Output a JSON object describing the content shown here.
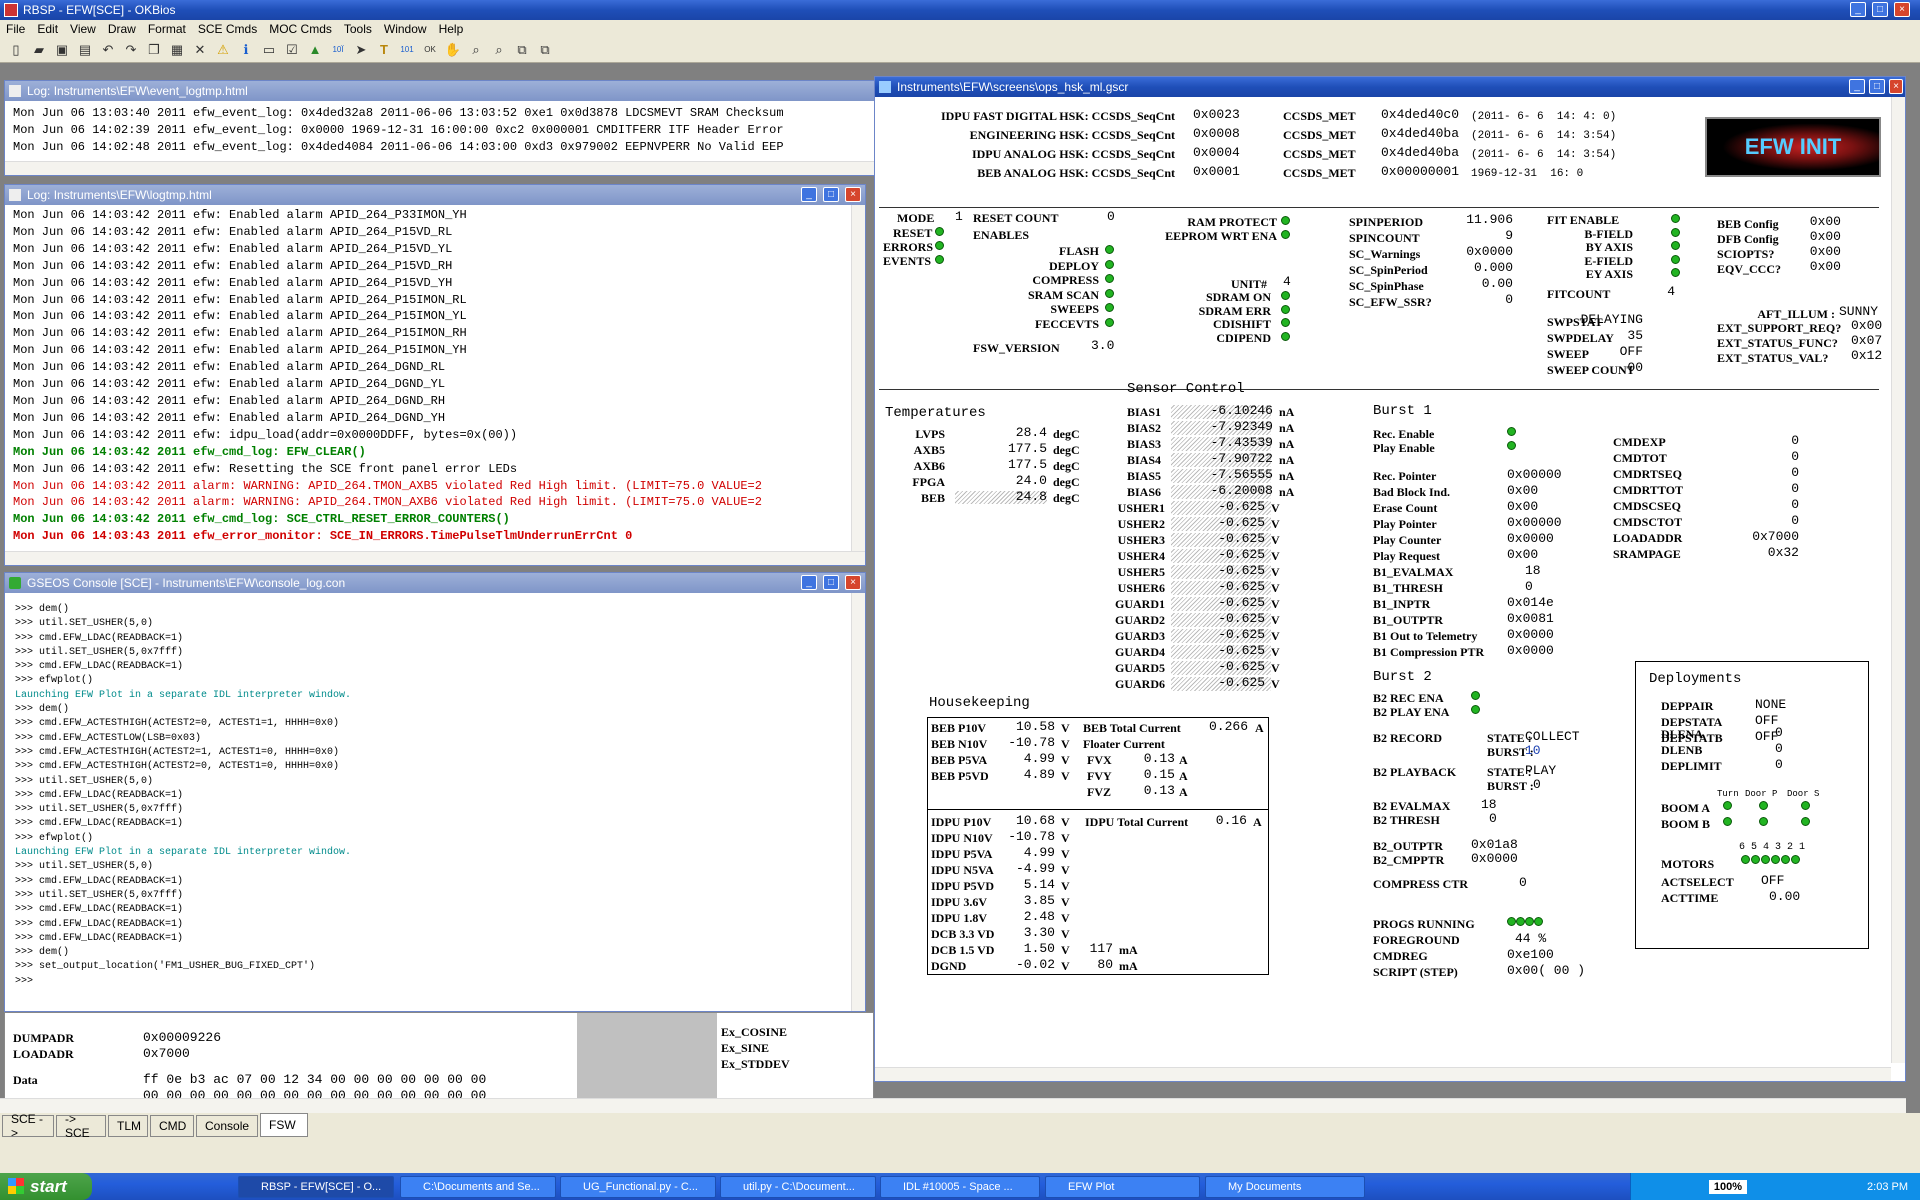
{
  "app": {
    "title": "RBSP - EFW[SCE] - OKBios"
  },
  "menu": [
    "File",
    "Edit",
    "View",
    "Draw",
    "Format",
    "SCE Cmds",
    "MOC Cmds",
    "Tools",
    "Window",
    "Help"
  ],
  "event_log": {
    "title": "Log: Instruments\\EFW\\event_logtmp.html",
    "lines": [
      "Mon Jun 06 13:03:40 2011 efw_event_log: 0x4ded32a8 2011-06-06 13:03:52 0xe1 0x0d3878 LDCSMEVT SRAM Checksum",
      "Mon Jun 06 14:02:39 2011 efw_event_log: 0x0000 1969-12-31 16:00:00 0xc2 0x000001 CMDITFERR ITF Header Error",
      "Mon Jun 06 14:02:48 2011 efw_event_log: 0x4ded4084 2011-06-06 14:03:00 0xd3 0x979002 EEPNVPERR No Valid EEP"
    ]
  },
  "logtmp": {
    "title": "Log: Instruments\\EFW\\logtmp.html",
    "lines": [
      {
        "t": "Mon Jun 06 14:03:42 2011 efw: Enabled alarm APID_264_P33IMON_YH",
        "c": "normal"
      },
      {
        "t": "Mon Jun 06 14:03:42 2011 efw: Enabled alarm APID_264_P15VD_RL",
        "c": "normal"
      },
      {
        "t": "Mon Jun 06 14:03:42 2011 efw: Enabled alarm APID_264_P15VD_YL",
        "c": "normal"
      },
      {
        "t": "Mon Jun 06 14:03:42 2011 efw: Enabled alarm APID_264_P15VD_RH",
        "c": "normal"
      },
      {
        "t": "Mon Jun 06 14:03:42 2011 efw: Enabled alarm APID_264_P15VD_YH",
        "c": "normal"
      },
      {
        "t": "Mon Jun 06 14:03:42 2011 efw: Enabled alarm APID_264_P15IMON_RL",
        "c": "normal"
      },
      {
        "t": "Mon Jun 06 14:03:42 2011 efw: Enabled alarm APID_264_P15IMON_YL",
        "c": "normal"
      },
      {
        "t": "Mon Jun 06 14:03:42 2011 efw: Enabled alarm APID_264_P15IMON_RH",
        "c": "normal"
      },
      {
        "t": "Mon Jun 06 14:03:42 2011 efw: Enabled alarm APID_264_P15IMON_YH",
        "c": "normal"
      },
      {
        "t": "Mon Jun 06 14:03:42 2011 efw: Enabled alarm APID_264_DGND_RL",
        "c": "normal"
      },
      {
        "t": "Mon Jun 06 14:03:42 2011 efw: Enabled alarm APID_264_DGND_YL",
        "c": "normal"
      },
      {
        "t": "Mon Jun 06 14:03:42 2011 efw: Enabled alarm APID_264_DGND_RH",
        "c": "normal"
      },
      {
        "t": "Mon Jun 06 14:03:42 2011 efw: Enabled alarm APID_264_DGND_YH",
        "c": "normal"
      },
      {
        "t": "Mon Jun 06 14:03:42 2011 efw: idpu_load(addr=0x0000DDFF, bytes=0x(00))",
        "c": "normal"
      },
      {
        "t": "Mon Jun 06 14:03:42 2011 efw_cmd_log: EFW_CLEAR()",
        "c": "green"
      },
      {
        "t": "Mon Jun 06 14:03:42 2011 efw: Resetting the SCE front panel error LEDs",
        "c": "normal"
      },
      {
        "t": "Mon Jun 06 14:03:42 2011 alarm: WARNING: APID_264.TMON_AXB5 violated Red High limit. (LIMIT=75.0 VALUE=2",
        "c": "red"
      },
      {
        "t": "Mon Jun 06 14:03:42 2011 alarm: WARNING: APID_264.TMON_AXB6 violated Red High limit. (LIMIT=75.0 VALUE=2",
        "c": "red"
      },
      {
        "t": "Mon Jun 06 14:03:42 2011 efw_cmd_log: SCE_CTRL_RESET_ERROR_COUNTERS()",
        "c": "green"
      },
      {
        "t": "Mon Jun 06 14:03:43 2011 efw_error_monitor: SCE_IN_ERRORS.TimePulseTlmUnderrunErrCnt 0",
        "c": "redbold"
      }
    ]
  },
  "console": {
    "title": "GSEOS Console  [SCE] - Instruments\\EFW\\console_log.con",
    "lines": [
      {
        "t": ">>> dem()",
        "c": "normal"
      },
      {
        "t": ">>> util.SET_USHER(5,0)",
        "c": "normal"
      },
      {
        "t": ">>> cmd.EFW_LDAC(READBACK=1)",
        "c": "normal"
      },
      {
        "t": ">>> util.SET_USHER(5,0x7fff)",
        "c": "normal"
      },
      {
        "t": ">>> cmd.EFW_LDAC(READBACK=1)",
        "c": "normal"
      },
      {
        "t": ">>> efwplot()",
        "c": "normal"
      },
      {
        "t": "Launching EFW Plot in a separate IDL interpreter window.",
        "c": "teal"
      },
      {
        "t": ">>> dem()",
        "c": "normal"
      },
      {
        "t": ">>> cmd.EFW_ACTESTHIGH(ACTEST2=0, ACTEST1=1, HHHH=0x0)",
        "c": "normal"
      },
      {
        "t": ">>> cmd.EFW_ACTESTLOW(LSB=0x03)",
        "c": "normal"
      },
      {
        "t": ">>> cmd.EFW_ACTESTHIGH(ACTEST2=1, ACTEST1=0, HHHH=0x0)",
        "c": "normal"
      },
      {
        "t": ">>> cmd.EFW_ACTESTHIGH(ACTEST2=0, ACTEST1=0, HHHH=0x0)",
        "c": "normal"
      },
      {
        "t": ">>> util.SET_USHER(5,0)",
        "c": "normal"
      },
      {
        "t": ">>> cmd.EFW_LDAC(READBACK=1)",
        "c": "normal"
      },
      {
        "t": ">>> util.SET_USHER(5,0x7fff)",
        "c": "normal"
      },
      {
        "t": ">>> cmd.EFW_LDAC(READBACK=1)",
        "c": "normal"
      },
      {
        "t": ">>> efwplot()",
        "c": "normal"
      },
      {
        "t": "Launching EFW Plot in a separate IDL interpreter window.",
        "c": "teal"
      },
      {
        "t": ">>> util.SET_USHER(5,0)",
        "c": "normal"
      },
      {
        "t": ">>> cmd.EFW_LDAC(READBACK=1)",
        "c": "normal"
      },
      {
        "t": ">>> util.SET_USHER(5,0x7fff)",
        "c": "normal"
      },
      {
        "t": ">>> cmd.EFW_LDAC(READBACK=1)",
        "c": "normal"
      },
      {
        "t": ">>> cmd.EFW_LDAC(READBACK=1)",
        "c": "normal"
      },
      {
        "t": ">>> cmd.EFW_LDAC(READBACK=1)",
        "c": "normal"
      },
      {
        "t": ">>> dem()",
        "c": "normal"
      },
      {
        "t": ">>> set_output_location('FM1_USHER_BUG_FIXED_CPT')",
        "c": "normal"
      },
      {
        "t": ">>>",
        "c": "normal"
      }
    ]
  },
  "bg_panel": {
    "dumpadr_label": "DUMPADR",
    "dumpadr": "0x00009226",
    "loadadr_label": "LOADADR",
    "loadadr": "0x7000",
    "data_label": "Data",
    "data_row1": "ff 0e b3 ac 07 00 12 34 00 00 00 00 00 00 00",
    "data_row2": "00 00 00 00 00 00 00 00 00 00 00 00 00 00 00",
    "ex_cosine": "Ex_COSINE",
    "ex_sine": "Ex_SINE",
    "ex_stddev": "Ex_STDDEV"
  },
  "tabs": [
    "SCE ->",
    "-> SCE",
    "TLM",
    "CMD",
    "Console",
    "FSW"
  ],
  "hsk": {
    "title": "Instruments\\EFW\\screens\\ops_hsk_ml.gscr",
    "logo": "EFW INIT",
    "header_rows": [
      {
        "label": "IDPU FAST DIGITAL HSK: CCSDS_SeqCnt",
        "seq": "0x0023",
        "met_label": "CCSDS_MET",
        "met": "0x4ded40c0",
        "time": "(2011- 6- 6  14: 4: 0)"
      },
      {
        "label": "ENGINEERING HSK: CCSDS_SeqCnt",
        "seq": "0x0008",
        "met_label": "CCSDS_MET",
        "met": "0x4ded40ba",
        "time": "(2011- 6- 6  14: 3:54)"
      },
      {
        "label": "IDPU ANALOG HSK: CCSDS_SeqCnt",
        "seq": "0x0004",
        "met_label": "CCSDS_MET",
        "met": "0x4ded40ba",
        "time": "(2011- 6- 6  14: 3:54)"
      },
      {
        "label": "BEB ANALOG HSK: CCSDS_SeqCnt",
        "seq": "0x0001",
        "met_label": "CCSDS_MET",
        "met": "0x00000001",
        "time": "1969-12-31  16: 0"
      }
    ],
    "mode": {
      "mode_label": "MODE",
      "mode": "1",
      "reset": "RESET",
      "errors": "ERRORS",
      "events": "EVENTS"
    },
    "reset_count_label": "RESET COUNT",
    "reset_count": "0",
    "enables_label": "ENABLES",
    "enables": [
      "FLASH",
      "DEPLOY",
      "COMPRESS",
      "SRAM SCAN",
      "SWEEPS",
      "FECCEVTS"
    ],
    "fsw_version_label": "FSW_VERSION",
    "fsw_version": "3.0",
    "ram_protect": "RAM PROTECT",
    "eeprom_wrt": "EEPROM WRT ENA",
    "unit_label": "UNIT#",
    "unit": "4",
    "unit_flags": [
      "SDRAM ON",
      "SDRAM ERR",
      "CDISHIFT",
      "CDIPEND"
    ],
    "spin": [
      {
        "l": "SPINPERIOD",
        "v": "11.906"
      },
      {
        "l": "SPINCOUNT",
        "v": "9"
      },
      {
        "l": "SC_Warnings",
        "v": "0x0000"
      },
      {
        "l": "SC_SpinPeriod",
        "v": "0.000"
      },
      {
        "l": "SC_SpinPhase",
        "v": "0.00"
      },
      {
        "l": "SC_EFW_SSR?",
        "v": "0"
      }
    ],
    "fit": {
      "fit_enable": "FIT ENABLE",
      "bfield": "B-FIELD",
      "byaxis": "BY AXIS",
      "efield": "E-FIELD",
      "eyaxis": "EY AXIS",
      "fitcount_label": "FITCOUNT",
      "fitcount": "4"
    },
    "config": [
      {
        "l": "BEB Config",
        "v": "0x00"
      },
      {
        "l": "DFB Config",
        "v": "0x00"
      },
      {
        "l": "SCIOPTS?",
        "v": "0x00"
      },
      {
        "l": "EQV_CCC?",
        "v": "0x00"
      }
    ],
    "aft_illum_label": "AFT_ILLUM :",
    "aft_illum": "SUNNY",
    "ext": [
      {
        "l": "EXT_SUPPORT_REQ?",
        "v": "0x00"
      },
      {
        "l": "EXT_STATUS_FUNC?",
        "v": "0x07"
      },
      {
        "l": "EXT_STATUS_VAL?",
        "v": "0x12"
      }
    ],
    "sweep": [
      {
        "l": "SWPSTAT",
        "v": "DELAYING"
      },
      {
        "l": "SWPDELAY",
        "v": "35"
      },
      {
        "l": "SWEEP",
        "v": "OFF"
      },
      {
        "l": "SWEEP COUNT",
        "v": "00"
      }
    ],
    "temps_title": "Temperatures",
    "temps": [
      {
        "l": "LVPS",
        "v": "28.4",
        "u": "degC"
      },
      {
        "l": "AXB5",
        "v": "177.5",
        "u": "degC"
      },
      {
        "l": "AXB6",
        "v": "177.5",
        "u": "degC"
      },
      {
        "l": "FPGA",
        "v": "24.0",
        "u": "degC"
      },
      {
        "l": "BEB",
        "v": "24.8",
        "u": "degC"
      }
    ],
    "sensor_title": "Sensor Control",
    "bias": [
      {
        "l": "BIAS1",
        "v": "-6.10246",
        "u": "nA"
      },
      {
        "l": "BIAS2",
        "v": "-7.92349",
        "u": "nA"
      },
      {
        "l": "BIAS3",
        "v": "-7.43539",
        "u": "nA"
      },
      {
        "l": "BIAS4",
        "v": "-7.90722",
        "u": "nA"
      },
      {
        "l": "BIAS5",
        "v": "-7.56555",
        "u": "nA"
      },
      {
        "l": "BIAS6",
        "v": "-6.20008",
        "u": "nA"
      }
    ],
    "usher": [
      {
        "l": "USHER1",
        "v": "-0.625",
        "u": "V"
      },
      {
        "l": "USHER2",
        "v": "-0.625",
        "u": "V"
      },
      {
        "l": "USHER3",
        "v": "-0.625",
        "u": "V"
      },
      {
        "l": "USHER4",
        "v": "-0.625",
        "u": "V"
      },
      {
        "l": "USHER5",
        "v": "-0.625",
        "u": "V"
      },
      {
        "l": "USHER6",
        "v": "-0.625",
        "u": "V"
      },
      {
        "l": "GUARD1",
        "v": "-0.625",
        "u": "V"
      },
      {
        "l": "GUARD2",
        "v": "-0.625",
        "u": "V"
      },
      {
        "l": "GUARD3",
        "v": "-0.625",
        "u": "V"
      },
      {
        "l": "GUARD4",
        "v": "-0.625",
        "u": "V"
      },
      {
        "l": "GUARD5",
        "v": "-0.625",
        "u": "V"
      },
      {
        "l": "GUARD6",
        "v": "-0.625",
        "u": "V"
      }
    ],
    "hk_title": "Housekeeping",
    "beb": [
      {
        "l": "BEB P10V",
        "v": "10.58",
        "u": "V"
      },
      {
        "l": "BEB N10V",
        "v": "-10.78",
        "u": "V"
      },
      {
        "l": "BEB P5VA",
        "v": "4.99",
        "u": "V"
      },
      {
        "l": "BEB P5VD",
        "v": "4.89",
        "u": "V"
      }
    ],
    "beb_total_label": "BEB Total Current",
    "beb_total": "0.266",
    "beb_total_unit": "A",
    "floater_label": "Floater Current",
    "floater": [
      {
        "l": "FVX",
        "v": "0.13",
        "u": "A"
      },
      {
        "l": "FVY",
        "v": "0.15",
        "u": "A"
      },
      {
        "l": "FVZ",
        "v": "0.13",
        "u": "A"
      }
    ],
    "idpu": [
      {
        "l": "IDPU P10V",
        "v": "10.68",
        "u": "V"
      },
      {
        "l": "IDPU N10V",
        "v": "-10.78",
        "u": "V"
      },
      {
        "l": "IDPU P5VA",
        "v": "4.99",
        "u": "V"
      },
      {
        "l": "IDPU N5VA",
        "v": "-4.99",
        "u": "V"
      },
      {
        "l": "IDPU P5VD",
        "v": "5.14",
        "u": "V"
      },
      {
        "l": "IDPU 3.6V",
        "v": "3.85",
        "u": "V"
      },
      {
        "l": "IDPU 1.8V",
        "v": "2.48",
        "u": "V"
      },
      {
        "l": "DCB 3.3 VD",
        "v": "3.30",
        "u": "V"
      },
      {
        "l": "DCB 1.5 VD",
        "v": "1.50",
        "u": "V"
      },
      {
        "l": "DGND",
        "v": "-0.02",
        "u": "V"
      }
    ],
    "idpu_total_label": "IDPU Total Current",
    "idpu_total": "0.16",
    "idpu_total_unit": "A",
    "dcb33_ma": "117",
    "dcb15_ma": "80",
    "ma_unit": "mA",
    "burst1_title": "Burst 1",
    "rec_enable": "Rec. Enable",
    "play_enable": "Play Enable",
    "burst1": [
      {
        "l": "Rec. Pointer",
        "v": "0x00000"
      },
      {
        "l": "Bad Block Ind.",
        "v": "0x00"
      },
      {
        "l": "Erase Count",
        "v": "0x00"
      },
      {
        "l": "Play Pointer",
        "v": "0x00000"
      },
      {
        "l": "Play Counter",
        "v": "0x0000"
      },
      {
        "l": "Play Request",
        "v": "0x00"
      },
      {
        "l": "B1_EVALMAX",
        "v": "18"
      },
      {
        "l": "B1_THRESH",
        "v": "0"
      },
      {
        "l": "B1_INPTR",
        "v": "0x014e"
      },
      {
        "l": "B1_OUTPTR",
        "v": "0x0081"
      },
      {
        "l": "B1 Out to Telemetry",
        "v": "0x0000"
      },
      {
        "l": "B1 Compression PTR",
        "v": "0x0000"
      }
    ],
    "cmd": [
      {
        "l": "CMDEXP",
        "v": "0"
      },
      {
        "l": "CMDTOT",
        "v": "0"
      },
      {
        "l": "CMDRTSEQ",
        "v": "0"
      },
      {
        "l": "CMDRTTOT",
        "v": "0"
      },
      {
        "l": "CMDSCSEQ",
        "v": "0"
      },
      {
        "l": "CMDSCTOT",
        "v": "0"
      },
      {
        "l": "LOADADDR",
        "v": "0x7000"
      },
      {
        "l": "SRAMPAGE",
        "v": "0x32"
      }
    ],
    "burst2_title": "Burst 2",
    "b2_rec_ena": "B2 REC ENA",
    "b2_play_ena": "B2 PLAY ENA",
    "b2_record": "B2 RECORD",
    "b2_playback": "B2 PLAYBACK",
    "state_label": "STATE :",
    "burst_label": "BURST :",
    "b2_record_state": "COLLECT",
    "b2_record_burst": "10",
    "b2_play_state": "PLAY",
    "b2_play_burst": "0",
    "b2_evalmax_label": "B2 EVALMAX",
    "b2_evalmax": "18",
    "b2_thresh_label": "B2 THRESH",
    "b2_thresh": "0",
    "b2_outptr_label": "B2_OUTPTR",
    "b2_outptr": "0x01a8",
    "b2_cmpptr_label": "B2_CMPPTR",
    "b2_cmpptr": "0x0000",
    "compress_ctr_label": "COMPRESS CTR",
    "compress_ctr": "0",
    "progs_label": "PROGS RUNNING",
    "foreground_label": "FOREGROUND",
    "foreground": "44 %",
    "cmdreg_label": "CMDREG",
    "cmdreg": "0xe100",
    "script_label": "SCRIPT (STEP)",
    "script": "0x00( 00 )",
    "deploy_title": "Deployments",
    "deploy": [
      {
        "l": "DEPPAIR",
        "v": "NONE"
      },
      {
        "l": "DEPSTATA",
        "v": "OFF"
      },
      {
        "l": "DEPSTATB",
        "v": "OFF"
      },
      {
        "l": "DLENA",
        "v": "0"
      },
      {
        "l": "DLENB",
        "v": "0"
      },
      {
        "l": "DEPLIMIT",
        "v": "0"
      }
    ],
    "turn": "Turn",
    "door_p": "Door P",
    "door_s": "Door S",
    "boom_a": "BOOM A",
    "boom_b": "BOOM B",
    "motor_nums": "6 5 4 3 2 1",
    "motors": "MOTORS",
    "actselect_label": "ACTSELECT",
    "actselect": "OFF",
    "acttime_label": "ACTTIME",
    "acttime": "0.00"
  },
  "taskbar": {
    "start": "start",
    "tasks": [
      "RBSP - EFW[SCE] - O...",
      "C:\\Documents and Se...",
      "UG_Functional.py - C...",
      "util.py - C:\\Document...",
      "IDL #10005 - Space ...",
      "EFW Plot",
      "My Documents"
    ],
    "zoom": "100%",
    "clock": "2:03 PM"
  },
  "colors": {
    "led_green": "#22b422",
    "log_green": "#008000",
    "log_red": "#d00000",
    "console_teal": "#008b8b"
  }
}
